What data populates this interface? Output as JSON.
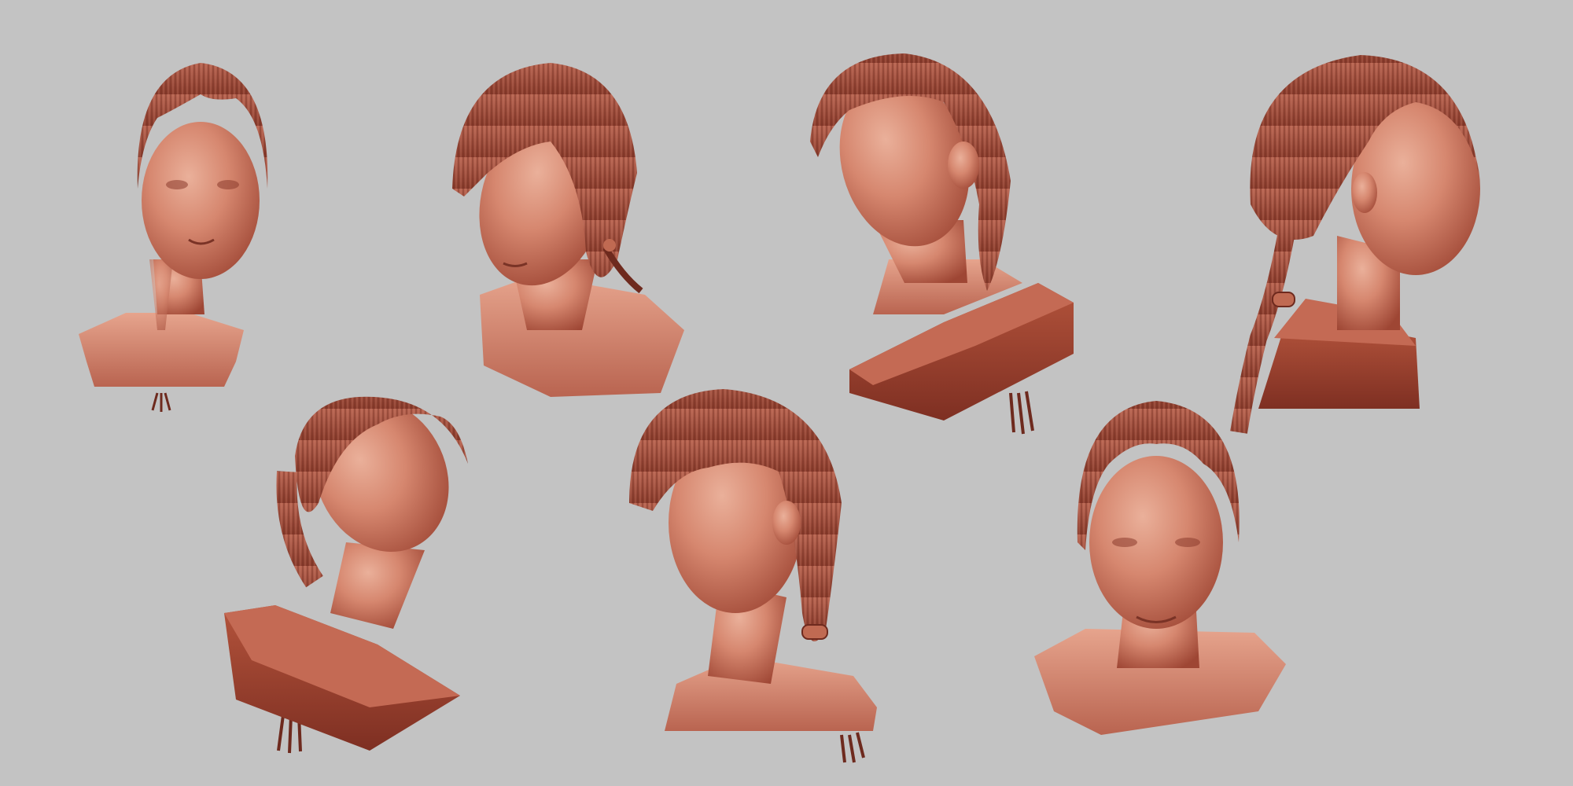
{
  "scene": {
    "background": "#c3c3c3",
    "clay_light": "#e2a58e",
    "clay_mid": "#c06a52",
    "clay_dark": "#8a3b2c",
    "hair_color": "#a2503e",
    "busts": [
      {
        "id": "front-view"
      },
      {
        "id": "three-quarter-down-left-view"
      },
      {
        "id": "three-quarter-up-left-view"
      },
      {
        "id": "right-profile-view"
      },
      {
        "id": "low-angle-up-view"
      },
      {
        "id": "left-three-quarter-view"
      },
      {
        "id": "front-down-view"
      }
    ]
  }
}
